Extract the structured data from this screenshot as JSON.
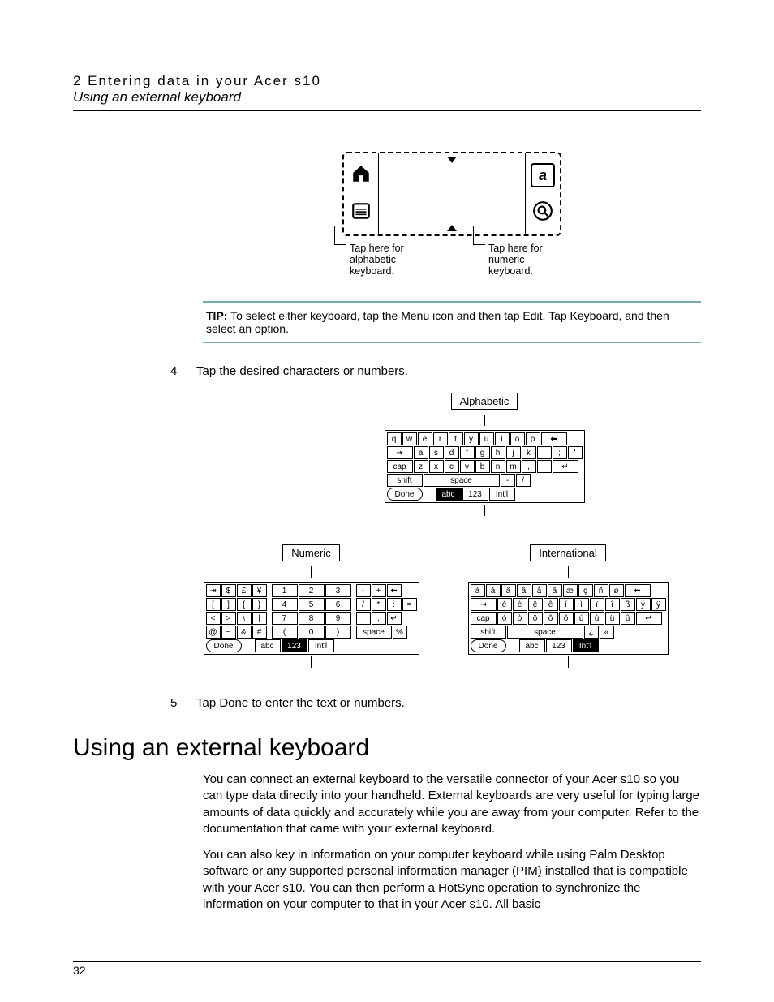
{
  "header": {
    "chapter": "2 Entering data in your Acer s10",
    "section": "Using an external keyboard"
  },
  "graffiti_callouts": {
    "left": "Tap here for alphabetic keyboard.",
    "right": "Tap here for numeric keyboard."
  },
  "tip": {
    "label": "TIP:",
    "text": "To select either keyboard, tap the Menu icon and then tap Edit. Tap Keyboard, and then select an option."
  },
  "steps": {
    "s4_num": "4",
    "s4_text": "Tap the desired characters or numbers.",
    "s5_num": "5",
    "s5_text": "Tap Done to enter the text or numbers."
  },
  "keyboards": {
    "alpha": {
      "title": "Alphabetic",
      "row1": [
        "q",
        "w",
        "e",
        "r",
        "t",
        "y",
        "u",
        "i",
        "o",
        "p"
      ],
      "row2_lead": "⇥",
      "row2": [
        "a",
        "s",
        "d",
        "f",
        "g",
        "h",
        "j",
        "k",
        "l",
        ";",
        "'"
      ],
      "row3_lead": "cap",
      "row3": [
        "z",
        "x",
        "c",
        "v",
        "b",
        "n",
        "m",
        ",",
        "."
      ],
      "row4_lead": "shift",
      "row4_space": "space",
      "row4_tail": [
        "-",
        "/"
      ],
      "bottom": {
        "done": "Done",
        "modes": [
          "abc",
          "123",
          "Int'l"
        ],
        "active": "abc"
      },
      "backspace": "⬅",
      "enter": "↵"
    },
    "numeric": {
      "title": "Numeric",
      "left_rows": [
        [
          "⇥",
          "$",
          "£",
          "¥"
        ],
        [
          "[",
          "]",
          "{",
          "}"
        ],
        [
          "<",
          ">",
          "\\",
          "|"
        ],
        [
          "@",
          "~",
          "&",
          "#"
        ]
      ],
      "pad": [
        [
          "1",
          "2",
          "3"
        ],
        [
          "4",
          "5",
          "6"
        ],
        [
          "7",
          "8",
          "9"
        ],
        [
          "(",
          "0",
          ")"
        ]
      ],
      "right_rows": [
        [
          "-",
          "+",
          "⬅"
        ],
        [
          "/",
          "*",
          ":",
          "="
        ],
        [
          ".",
          ",",
          "↵"
        ],
        [
          "space",
          "%"
        ]
      ],
      "bottom": {
        "done": "Done",
        "modes": [
          "abc",
          "123",
          "Int'l"
        ],
        "active": "123"
      }
    },
    "intl": {
      "title": "International",
      "row1": [
        "á",
        "à",
        "ä",
        "â",
        "å",
        "ã",
        "æ",
        "ç",
        "ñ",
        "ø"
      ],
      "row2_lead": "⇥",
      "row2": [
        "é",
        "è",
        "ë",
        "ê",
        "í",
        "ì",
        "ï",
        "î",
        "ß",
        "ý",
        "ÿ"
      ],
      "row3_lead": "cap",
      "row3": [
        "ó",
        "ò",
        "ö",
        "ô",
        "õ",
        "ú",
        "ù",
        "ü",
        "û"
      ],
      "row4_lead": "shift",
      "row4_space": "space",
      "row4_tail": [
        "¿",
        "«"
      ],
      "bottom": {
        "done": "Done",
        "modes": [
          "abc",
          "123",
          "Int'l"
        ],
        "active": "Int'l"
      },
      "backspace": "⬅",
      "enter": "↵"
    }
  },
  "heading": "Using an external keyboard",
  "paragraphs": {
    "p1": "You can connect an external keyboard to the versatile connector of your Acer s10 so you can type data directly into your handheld. External keyboards are very useful for typing large amounts of data quickly and accurately while you are away from your computer. Refer to the documentation that came with your external keyboard.",
    "p2": "You can also key in information on your computer keyboard while using Palm Desktop software or any supported personal information manager (PIM) installed that is compatible with your Acer s10. You can then perform a HotSync operation to synchronize the information on your computer to that in your Acer s10. All basic"
  },
  "page_number": "32"
}
